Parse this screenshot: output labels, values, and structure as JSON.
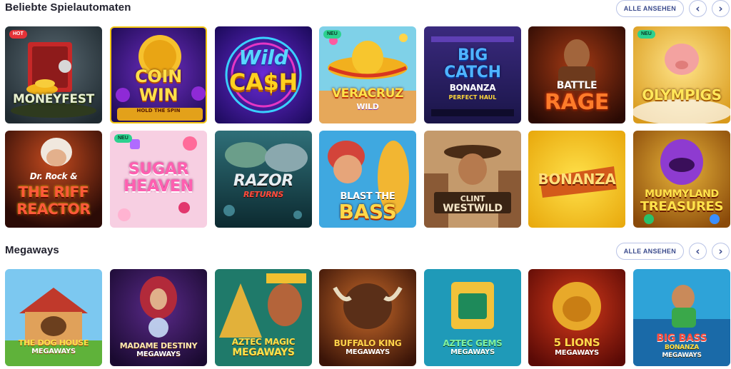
{
  "sections": [
    {
      "title": "Beliebte Spielautomaten",
      "all_label": "ALLE ANSEHEN",
      "prev_icon": "‹",
      "next_icon": "›"
    },
    {
      "title": "Megaways",
      "all_label": "ALLE ANSEHEN",
      "prev_icon": "‹",
      "next_icon": "›"
    }
  ],
  "badges": {
    "hot": "HOT",
    "new": "NEU"
  },
  "games": {
    "moneyfest": {
      "title": "MONEYFEST",
      "badge": "HOT"
    },
    "coinwin": {
      "line1": "COIN",
      "line2": "WIN",
      "sub": "HOLD THE SPIN"
    },
    "wildcash": {
      "line1": "Wild",
      "line2": "CA$H"
    },
    "veracruz": {
      "line1": "VERACRUZ",
      "line2": "WILD",
      "badge": "NEU"
    },
    "bigcatch": {
      "line1": "BIG",
      "line2": "CATCH",
      "line3": "BONANZA",
      "sub": "PERFECT HAUL"
    },
    "battlerage": {
      "line1": "BATTLE",
      "line2": "RAGE"
    },
    "olympigs": {
      "title": "OLYMPIGS",
      "badge": "NEU"
    },
    "riffreactor": {
      "line1": "Dr. Rock &",
      "line2": "THE RIFF",
      "line3": "REACTOR"
    },
    "sugarheaven": {
      "line1": "SUGAR",
      "line2": "HEAVEN",
      "badge": "NEU"
    },
    "razor": {
      "line1": "RAZOR",
      "line2": "RETURNS"
    },
    "blastbass": {
      "line1": "BLAST THE",
      "line2": "BASS"
    },
    "clint": {
      "line1": "CLINT",
      "line2": "WESTWILD"
    },
    "bonanza": {
      "title": "BONANZA"
    },
    "mummyland": {
      "line1": "MUMMYLAND",
      "line2": "TREASURES"
    },
    "doghouse": {
      "line1": "THE DOG HOUSE",
      "line2": "MEGAWAYS"
    },
    "madame": {
      "line1": "MADAME DESTINY",
      "line2": "MEGAWAYS"
    },
    "aztecmagic": {
      "line1": "AZTEC MAGIC",
      "line2": "MEGAWAYS"
    },
    "buffalo": {
      "line1": "BUFFALO KING",
      "line2": "MEGAWAYS"
    },
    "aztecgems": {
      "line1": "AZTEC GEMS",
      "line2": "MEGAWAYS"
    },
    "fivelions": {
      "line1": "5 LIONS",
      "line2": "MEGAWAYS"
    },
    "bigbass": {
      "line1": "BIG BASS",
      "line2": "BONANZA",
      "line3": "MEGAWAYS"
    }
  }
}
